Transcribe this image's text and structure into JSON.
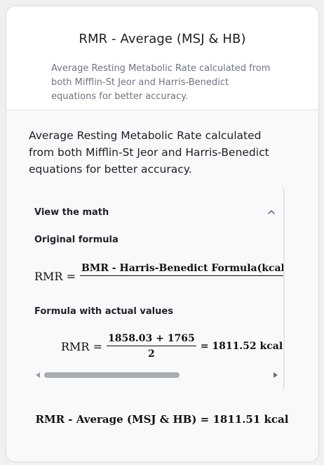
{
  "card": {
    "title": "RMR - Average (MSJ & HB)",
    "description": "Average Resting Metabolic Rate calculated from both Mifflin-St Jeor and Harris-Benedict equations for better accuracy."
  },
  "body_text": "Average Resting Metabolic Rate calculated from both Mifflin-St Jeor and Harris-Benedict equations for better accuracy.",
  "math": {
    "toggle_label": "View the math",
    "toggle_icon": "chevron-up-icon",
    "original_label": "Original formula",
    "original": {
      "lhs": "RMR =",
      "numerator": "BMR - Harris-Benedict Formula(kcal) + BMR - Mifflin-St Jeor Formula(kcal)",
      "denominator": "2"
    },
    "actual_label": "Formula with actual values",
    "actual": {
      "lhs": "RMR =",
      "numerator": "1858.03 + 1765",
      "denominator": "2",
      "rhs": "= 1811.52 kcal"
    },
    "scroll_position": 0.6
  },
  "result": "RMR - Average (MSJ & HB) = 1811.51 kcal",
  "colors": {
    "card_bg": "#f8f9fa",
    "header_bg": "#ffffff",
    "muted_text": "#6e7480"
  }
}
